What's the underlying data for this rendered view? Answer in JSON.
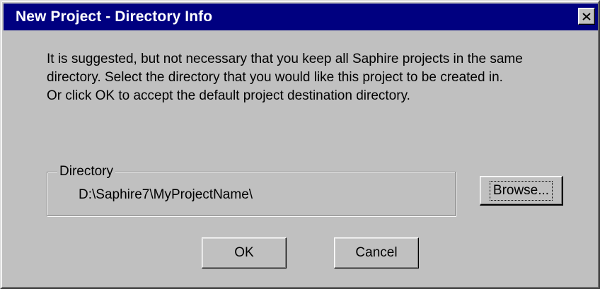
{
  "window": {
    "title": "New Project - Directory Info",
    "close_icon": "close-x-icon"
  },
  "message": {
    "line1": "It is suggested, but not necessary that you keep all Saphire projects in the same",
    "line2": "directory.  Select the directory that you would like this project to be created in.",
    "line3": "Or click OK to accept the default project destination directory."
  },
  "directory": {
    "legend": "Directory",
    "path": "D:\\Saphire7\\MyProjectName\\"
  },
  "buttons": {
    "browse_label": "Browse...",
    "ok_label": "OK",
    "cancel_label": "Cancel"
  },
  "colors": {
    "titlebar": "#000080",
    "face": "#c0c0c0",
    "title_text": "#ffffff"
  }
}
